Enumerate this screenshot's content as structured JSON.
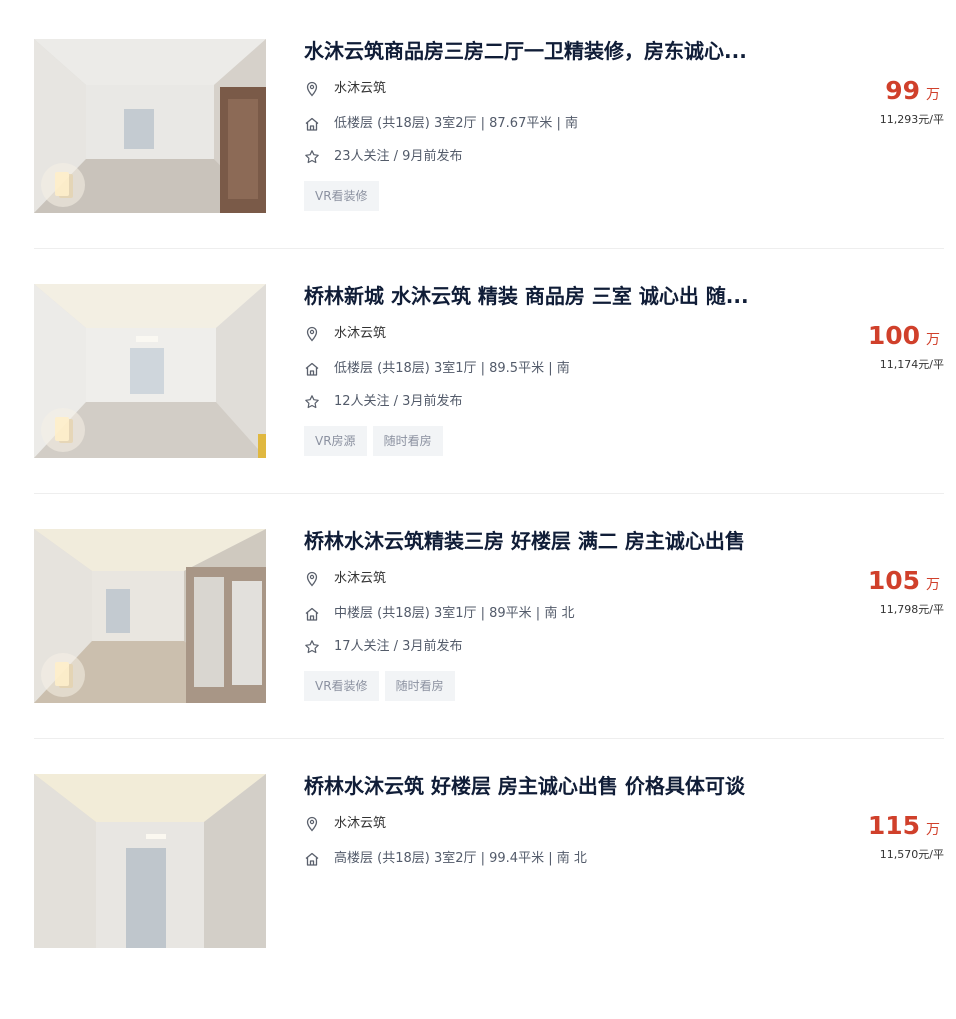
{
  "listings": [
    {
      "title": "水沐云筑商品房三房二厅一卫精装修，房东诚心...",
      "community": "水沐云筑",
      "house_info": "低楼层 (共18层) 3室2厅 | 87.67平米 | 南",
      "follow_info": "23人关注 / 9月前发布",
      "tags": [
        "VR看装修"
      ],
      "total_price": "99",
      "total_unit": "万",
      "unit_price": "11,293元/平"
    },
    {
      "title": "桥林新城 水沐云筑 精装 商品房 三室 诚心出 随...",
      "community": "水沐云筑",
      "house_info": "低楼层 (共18层) 3室1厅 | 89.5平米 | 南",
      "follow_info": "12人关注 / 3月前发布",
      "tags": [
        "VR房源",
        "随时看房"
      ],
      "total_price": "100",
      "total_unit": "万",
      "unit_price": "11,174元/平"
    },
    {
      "title": "桥林水沐云筑精装三房 好楼层 满二 房主诚心出售",
      "community": "水沐云筑",
      "house_info": "中楼层 (共18层) 3室1厅 | 89平米 | 南 北",
      "follow_info": "17人关注 / 3月前发布",
      "tags": [
        "VR看装修",
        "随时看房"
      ],
      "total_price": "105",
      "total_unit": "万",
      "unit_price": "11,798元/平"
    },
    {
      "title": "桥林水沐云筑 好楼层 房主诚心出售 价格具体可谈",
      "community": "水沐云筑",
      "house_info": "高楼层 (共18层) 3室2厅 | 99.4平米 | 南 北",
      "follow_info": "",
      "tags": [],
      "total_price": "115",
      "total_unit": "万",
      "unit_price": "11,570元/平"
    }
  ],
  "icons": {
    "location": "location-pin-icon",
    "house": "house-icon",
    "follow": "star-icon",
    "vr": "vr-cube-icon"
  },
  "colors": {
    "price": "#d0402b",
    "title": "#101d37",
    "tag_bg": "#f2f4f6"
  }
}
